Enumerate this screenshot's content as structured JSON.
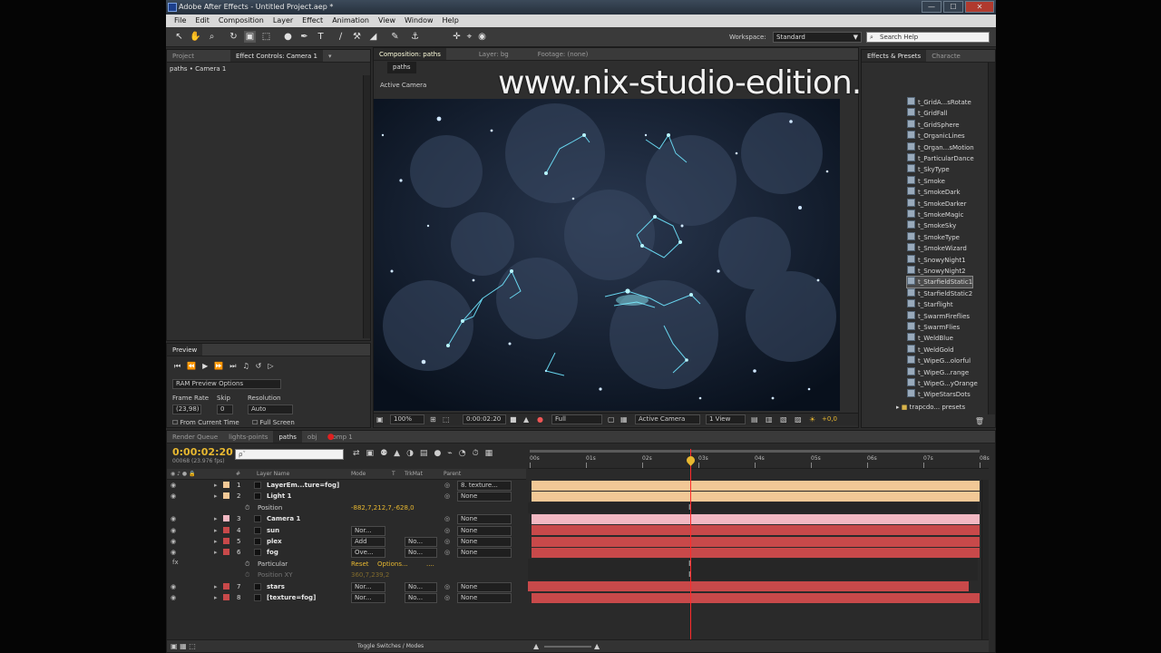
{
  "window": {
    "title": "Adobe After Effects - Untitled Project.aep *",
    "controls": [
      "—",
      "☐",
      "✕"
    ]
  },
  "menu": [
    "File",
    "Edit",
    "Composition",
    "Layer",
    "Effect",
    "Animation",
    "View",
    "Window",
    "Help"
  ],
  "toolbar": {
    "workspace_label": "Workspace:",
    "workspace_value": "Standard",
    "search_placeholder": "Search Help"
  },
  "watermark": "www.nix-studio-edition.ru",
  "left_panel": {
    "tabs": [
      "Project",
      "Effect Controls: Camera 1"
    ],
    "path": "paths • Camera 1"
  },
  "preview": {
    "tab": "Preview",
    "ram": "RAM Preview Options",
    "frame_rate_label": "Frame Rate",
    "skip_label": "Skip",
    "resolution_label": "Resolution",
    "frame_rate": "(23,98)",
    "skip": "0",
    "resolution": "Auto",
    "from_current": "From Current Time",
    "full_screen": "Full Screen"
  },
  "comp": {
    "tabs": [
      "Composition: paths",
      "Layer: bg",
      "Footage: (none)"
    ],
    "sub_tab": "paths",
    "camera_label": "Active Camera",
    "zoom": "100%",
    "timecode": "0:00:02:20",
    "quality": "Full",
    "camera": "Active Camera",
    "views": "1 View",
    "offset": "+0,0"
  },
  "effects": {
    "tabs": [
      "Effects & Presets",
      "Characte"
    ],
    "items": [
      "t_GridA...sRotate",
      "t_GridFall",
      "t_GridSphere",
      "t_OrganicLines",
      "t_Organ...sMotion",
      "t_ParticularDance",
      "t_SkyType",
      "t_Smoke",
      "t_SmokeDark",
      "t_SmokeDarker",
      "t_SmokeMagic",
      "t_SmokeSky",
      "t_SmokeType",
      "t_SmokeWizard",
      "t_SnowyNight1",
      "t_SnowyNight2",
      "t_StarfieldStatic1",
      "t_StarfieldStatic2",
      "t_Starflight",
      "t_SwarmFireflies",
      "t_SwarmFlies",
      "t_WeldBlue",
      "t_WeldGold",
      "t_WipeG...olorful",
      "t_WipeG...range",
      "t_WipeG...yOrange",
      "t_WipeStarsDots"
    ],
    "folder": "trapcdo... presets"
  },
  "timeline": {
    "tabs": [
      "Render Queue",
      "lights-points",
      "paths",
      "obj",
      "Comp 1"
    ],
    "timecode": "0:00:02:20",
    "fps": "00068 (23.976 fps)",
    "search_placeholder": "ρˇ",
    "headers": {
      "num": "#",
      "name": "Layer Name",
      "mode": "Mode",
      "t": "T",
      "trkmat": "TrkMat",
      "parent": "Parent"
    },
    "ruler": [
      "00s",
      "01s",
      "02s",
      "03s",
      "04s",
      "05s",
      "06s",
      "07s",
      "08s"
    ],
    "footer": "Toggle Switches / Modes",
    "layers": [
      {
        "num": "1",
        "name": "LayerEm...ture=fog]",
        "parent": "8. texture..."
      },
      {
        "num": "2",
        "name": "Light 1",
        "parent": "None"
      },
      {
        "sub": "Position",
        "value": "-882,7,212,7,-628,0"
      },
      {
        "num": "3",
        "name": "Camera 1",
        "parent": "None"
      },
      {
        "num": "4",
        "name": "sun",
        "mode": "Nor...",
        "parent": "None"
      },
      {
        "num": "5",
        "name": "plex",
        "mode": "Add",
        "trkmat": "No...",
        "parent": "None"
      },
      {
        "num": "6",
        "name": "fog",
        "mode": "Ove...",
        "trkmat": "No...",
        "parent": "None"
      },
      {
        "sub": "Particular",
        "reset": "Reset",
        "options": "Options...",
        "dots": "...."
      },
      {
        "sub": "Position XY",
        "value": "360,7,239,2"
      },
      {
        "num": "7",
        "name": "stars",
        "mode": "Nor...",
        "trkmat": "No...",
        "parent": "None"
      },
      {
        "num": "8",
        "name": "[texture=fog]",
        "mode": "Nor...",
        "trkmat": "No...",
        "parent": "None"
      }
    ]
  },
  "colors": {
    "accent": "#e8b830",
    "light_bar": "#f2c896",
    "camera_bar": "#f2b8c2",
    "red_bar": "#c8494a",
    "playhead": "#ff2b2b"
  }
}
